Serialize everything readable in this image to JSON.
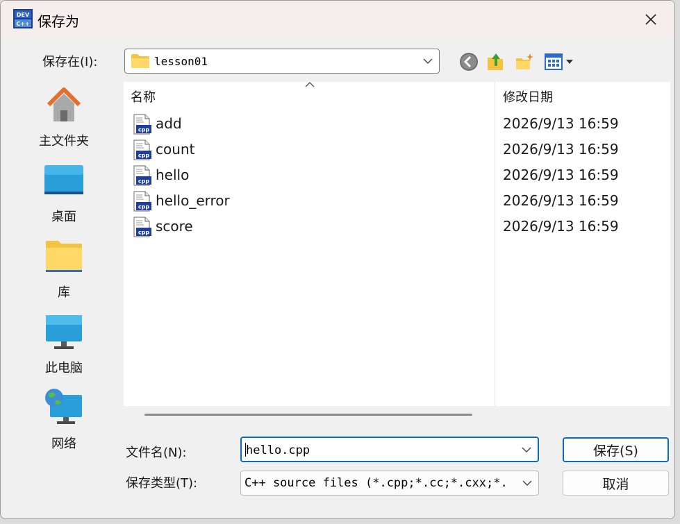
{
  "window": {
    "title": "保存为",
    "app_icon": "devcpp-icon",
    "close_icon": "close-icon"
  },
  "location": {
    "label": "保存在(I):",
    "value": "lesson01",
    "toolbar_icons": [
      "back-icon",
      "up-folder-icon",
      "new-folder-icon",
      "view-menu-icon"
    ]
  },
  "places": [
    {
      "label": "主文件夹",
      "icon": "home-icon"
    },
    {
      "label": "桌面",
      "icon": "desktop-icon"
    },
    {
      "label": "库",
      "icon": "library-folder-icon"
    },
    {
      "label": "此电脑",
      "icon": "computer-icon"
    },
    {
      "label": "网络",
      "icon": "network-icon"
    }
  ],
  "file_list": {
    "columns": [
      "名称",
      "修改日期"
    ],
    "rows": [
      {
        "name": "add",
        "modified": "2026/9/13 16:59"
      },
      {
        "name": "count",
        "modified": "2026/9/13 16:59"
      },
      {
        "name": "hello",
        "modified": "2026/9/13 16:59"
      },
      {
        "name": "hello_error",
        "modified": "2026/9/13 16:59"
      },
      {
        "name": "score",
        "modified": "2026/9/13 16:59"
      }
    ]
  },
  "filename": {
    "label": "文件名(N):",
    "value": "hello.cpp"
  },
  "filetype": {
    "label": "保存类型(T):",
    "value": "C++ source files (*.cpp;*.cc;*.cxx;*."
  },
  "buttons": {
    "save": "保存(S)",
    "cancel": "取消"
  },
  "colors": {
    "accent": "#0f6cbd",
    "folder": "#f5c342",
    "titlebar": "#f6eeec"
  }
}
